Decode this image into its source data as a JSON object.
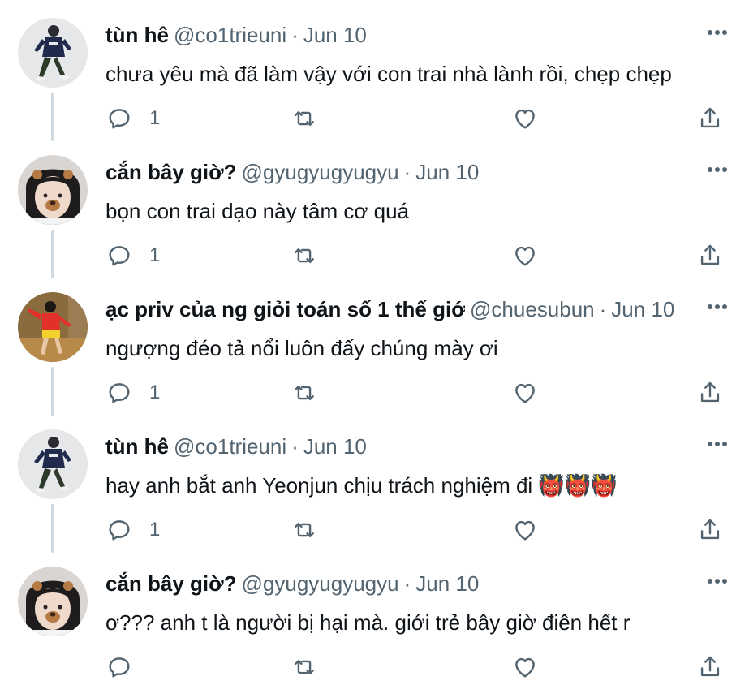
{
  "colors": {
    "text_primary": "#0f1419",
    "text_secondary": "#536471",
    "thread_line": "#cfd9de",
    "icon": "#536471"
  },
  "tweets": [
    {
      "name": "tùn hê",
      "handle": "@co1trieuni",
      "separator": "·",
      "date": "Jun 10",
      "text": "chưa yêu mà đã làm vậy với con trai nhà lành rồi, chẹp chẹp",
      "reply_count": "1",
      "avatar_icon": "avatar-person-jacket-icon"
    },
    {
      "name": "cắn bây giờ?",
      "handle": "@gyugyugyugyu",
      "separator": "·",
      "date": "Jun 10",
      "text": "bọn con trai dạo này tâm cơ quá",
      "reply_count": "1",
      "avatar_icon": "avatar-bear-filter-icon"
    },
    {
      "name": "ạc priv của ng giỏi toán số 1 thế giới",
      "handle": "@chuesubun",
      "separator": "·",
      "date": "Jun 10",
      "text": "ngượng đéo tả nổi luôn đấy chúng mày ơi",
      "reply_count": "1",
      "avatar_icon": "avatar-person-red-shirt-icon"
    },
    {
      "name": "tùn hê",
      "handle": "@co1trieuni",
      "separator": "·",
      "date": "Jun 10",
      "text": "hay anh bắt anh Yeonjun chịu trách nghiệm đi 👹👹👹",
      "reply_count": "1",
      "avatar_icon": "avatar-person-jacket-icon"
    },
    {
      "name": "cắn bây giờ?",
      "handle": "@gyugyugyugyu",
      "separator": "·",
      "date": "Jun 10",
      "text": "ơ??? anh t là người bị hại mà. giới trẻ bây giờ điên hết r",
      "reply_count": "",
      "avatar_icon": "avatar-bear-filter-icon"
    }
  ],
  "icons": {
    "more": "more-dots-icon",
    "reply": "reply-icon",
    "retweet": "retweet-icon",
    "like": "like-icon",
    "share": "share-icon"
  }
}
